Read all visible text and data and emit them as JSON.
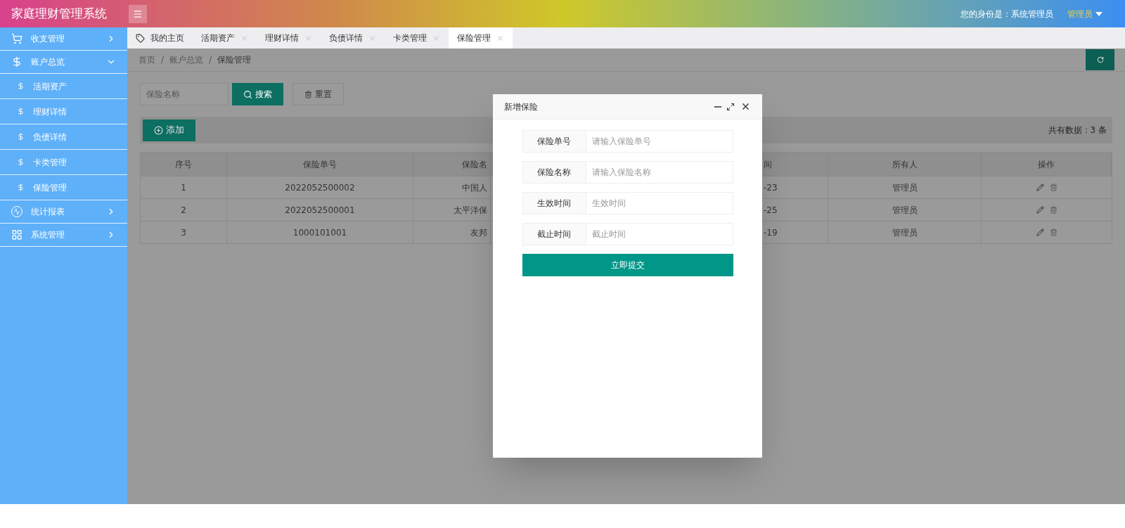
{
  "header": {
    "title": "家庭理财管理系统",
    "identity": "您的身份是：系统管理员",
    "user": "管理员"
  },
  "sidebar": {
    "items": [
      {
        "label": "收支管理",
        "expanded": false
      },
      {
        "label": "账户总览",
        "expanded": true,
        "children": [
          {
            "label": "活期资产"
          },
          {
            "label": "理财详情"
          },
          {
            "label": "负债详情"
          },
          {
            "label": "卡类管理"
          },
          {
            "label": "保险管理"
          }
        ]
      },
      {
        "label": "统计报表",
        "expanded": false
      },
      {
        "label": "系统管理",
        "expanded": false
      }
    ]
  },
  "tabs": [
    {
      "label": "我的主页",
      "kind": "home",
      "selected": false
    },
    {
      "label": "活期资产",
      "kind": "closable",
      "selected": false
    },
    {
      "label": "理财详情",
      "kind": "closable",
      "selected": false
    },
    {
      "label": "负债详情",
      "kind": "closable",
      "selected": false
    },
    {
      "label": "卡类管理",
      "kind": "closable",
      "selected": false
    },
    {
      "label": "保险管理",
      "kind": "closable",
      "selected": true
    }
  ],
  "breadcrumb": {
    "separator": "/",
    "items": [
      "首页",
      "账户总览",
      "保险管理"
    ]
  },
  "search": {
    "placeholder": "保险名称",
    "search_button": "搜索",
    "reset_button": "重置"
  },
  "toolbar": {
    "add_button": "添加",
    "total": "共有数据：3 条"
  },
  "table": {
    "columns": [
      "序号",
      "保险单号",
      "保险名",
      "间",
      "所有人",
      "操作"
    ],
    "rows": [
      [
        "1",
        "2022052500002",
        "中国人",
        "-23",
        "管理员"
      ],
      [
        "2",
        "2022052500001",
        "太平洋保",
        "-25",
        "管理员"
      ],
      [
        "3",
        "1000101001",
        "友邦",
        "-19",
        "管理员"
      ]
    ]
  },
  "dialog": {
    "title": "新增保险",
    "fields": [
      {
        "label": "保险单号",
        "placeholder": "请输入保险单号"
      },
      {
        "label": "保险名称",
        "placeholder": "请输入保险名称"
      },
      {
        "label": "生效时间",
        "placeholder": "生效时间"
      },
      {
        "label": "截止时间",
        "placeholder": "截止时间"
      }
    ],
    "submit": "立即提交"
  }
}
